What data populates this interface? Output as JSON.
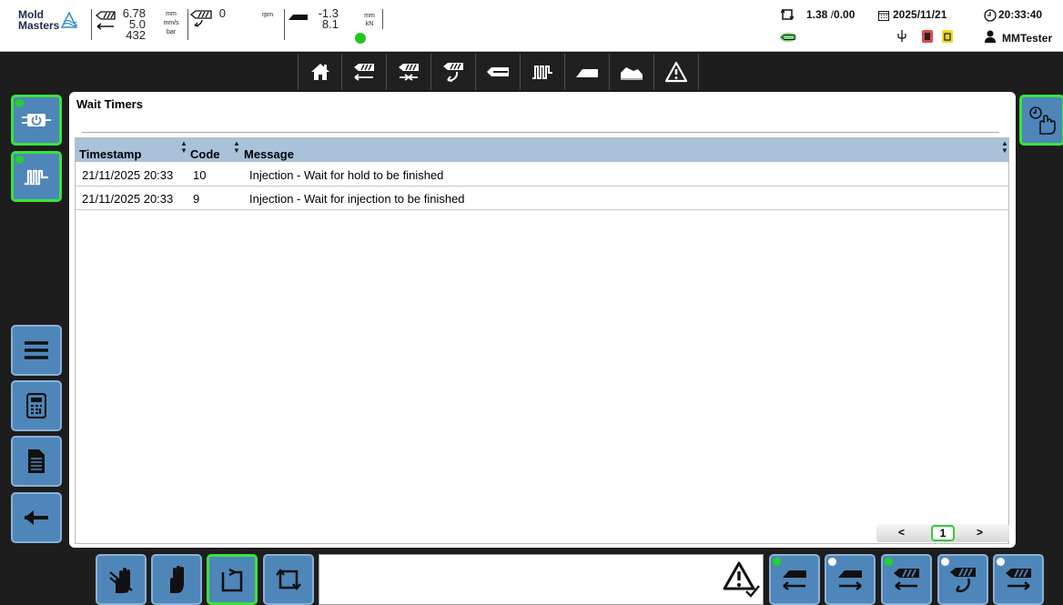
{
  "header": {
    "logo": {
      "line1": "Mold",
      "line2": "Masters"
    },
    "injection_position": "6.78",
    "injection_position_unit": "mm",
    "injection_speed": "5.0",
    "injection_speed_unit": "mm/s",
    "injection_pressure": "432",
    "injection_pressure_unit": "bar",
    "screw_rpm": "0",
    "screw_rpm_unit": "rpm",
    "carriage_position": "-1.3",
    "carriage_position_unit": "mm",
    "carriage_force": "8.1",
    "carriage_force_unit": "kN",
    "cycle_times": "1.38",
    "cycle_times_second": "0.00",
    "date": "2025/11/21",
    "time": "20:33:40",
    "user": "MMTester"
  },
  "panel": {
    "title": "Wait Timers",
    "columns": [
      "Timestamp",
      "Code",
      "Message"
    ],
    "rows": [
      {
        "timestamp": "21/11/2025 20:33",
        "code": "10",
        "message": "Injection - Wait for hold to be finished"
      },
      {
        "timestamp": "21/11/2025 20:33",
        "code": "9",
        "message": "Injection - Wait for injection to be finished"
      }
    ],
    "pager": {
      "prev": "<",
      "current": "1",
      "next": ">"
    }
  }
}
